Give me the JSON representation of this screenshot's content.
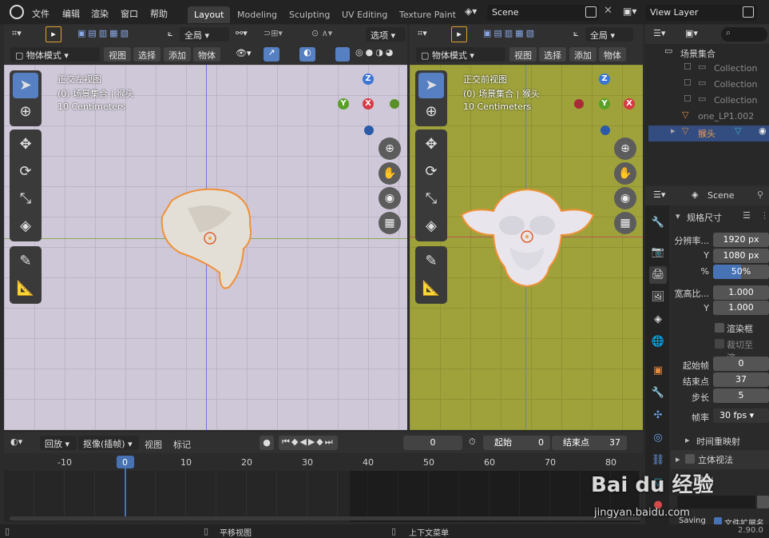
{
  "topbar": {
    "menus": [
      "文件",
      "编辑",
      "渲染",
      "窗口",
      "帮助"
    ],
    "tabs": [
      "Layout",
      "Modeling",
      "Sculpting",
      "UV Editing",
      "Texture Paint"
    ],
    "scene": "Scene",
    "view_layer": "View Layer"
  },
  "left_vp": {
    "header": {
      "mode": "物体模式",
      "view": "视图",
      "select": "选择",
      "add": "添加",
      "object": "物体",
      "orientation": "全局"
    },
    "title": "正交左视图",
    "collection": "(0) 场景集合 | 猴头",
    "scale": "10 Centimeters"
  },
  "right_vp": {
    "header": {
      "mode": "物体模式",
      "view": "视图",
      "select": "选择",
      "add": "添加",
      "object": "物体",
      "orientation": "全局",
      "options": "选项"
    },
    "title": "正交前视图",
    "collection": "(0) 场景集合 | 猴头",
    "scale": "10 Centimeters"
  },
  "axes": {
    "z": "Z",
    "x": "X",
    "y": "Y"
  },
  "outliner": {
    "root": "场景集合",
    "rows": [
      "Collection",
      "Collection",
      "Collection",
      "one_LP1.002",
      "猴头"
    ]
  },
  "properties": {
    "scene": "Scene",
    "panel": "规格尺寸",
    "res_label": "分辨率...",
    "res_x": "1920 px",
    "res_y": "1080 px",
    "y_label": "Y",
    "pct_label": "%",
    "pct": "50%",
    "aspect_label": "宽高比...",
    "aspect_x": "1.000",
    "aspect_y": "1.000",
    "border": "渲染框",
    "crop": "裁切至渲...",
    "frame_start_label": "起始帧",
    "frame_start": "0",
    "frame_end_label": "结束点",
    "frame_end": "37",
    "step_label": "步长",
    "step": "5",
    "fps_label": "帧率",
    "fps": "30 fps",
    "remap": "时间重映射",
    "stereo": "立体视法",
    "output": "输出",
    "saving": "Saving",
    "ext": "文件扩展名"
  },
  "timeline": {
    "playback": "回放",
    "keying": "抠像(插帧)",
    "view": "视图",
    "marker": "标记",
    "current": "0",
    "start_label": "起始",
    "start": "0",
    "end_label": "结束点",
    "end": "37",
    "ticks": [
      "-10",
      "0",
      "10",
      "20",
      "30",
      "40",
      "50",
      "60",
      "70",
      "80"
    ]
  },
  "status": {
    "pan": "平移视图",
    "ctx": "上下文菜单",
    "version": "2.90.0"
  },
  "watermark": {
    "brand": "Bai du 经验",
    "url": "jingyan.baidu.com"
  }
}
